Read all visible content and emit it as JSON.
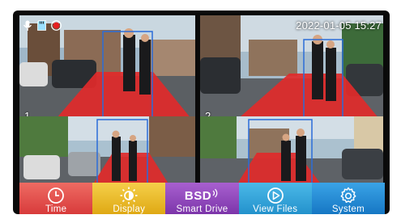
{
  "status": {
    "icons": [
      "mic-icon",
      "sd-card-icon",
      "record-icon"
    ],
    "datetime": "2022-01-05  15:27"
  },
  "channels": [
    {
      "number": "1"
    },
    {
      "number": "2"
    },
    {
      "number": ""
    },
    {
      "number": ""
    }
  ],
  "menu": {
    "items": [
      {
        "label": "Time",
        "icon": "clock-icon",
        "color": "#e24a4a"
      },
      {
        "label": "Display",
        "icon": "brightness-icon",
        "color": "#e7b728"
      },
      {
        "label": "Smart Drive",
        "icon": "bsd-icon",
        "icon_text": "BSD",
        "color": "#8b3fb8"
      },
      {
        "label": "View Files",
        "icon": "play-icon",
        "color": "#2fa1d6"
      },
      {
        "label": "System",
        "icon": "gear-icon",
        "color": "#1e88d2"
      }
    ]
  }
}
